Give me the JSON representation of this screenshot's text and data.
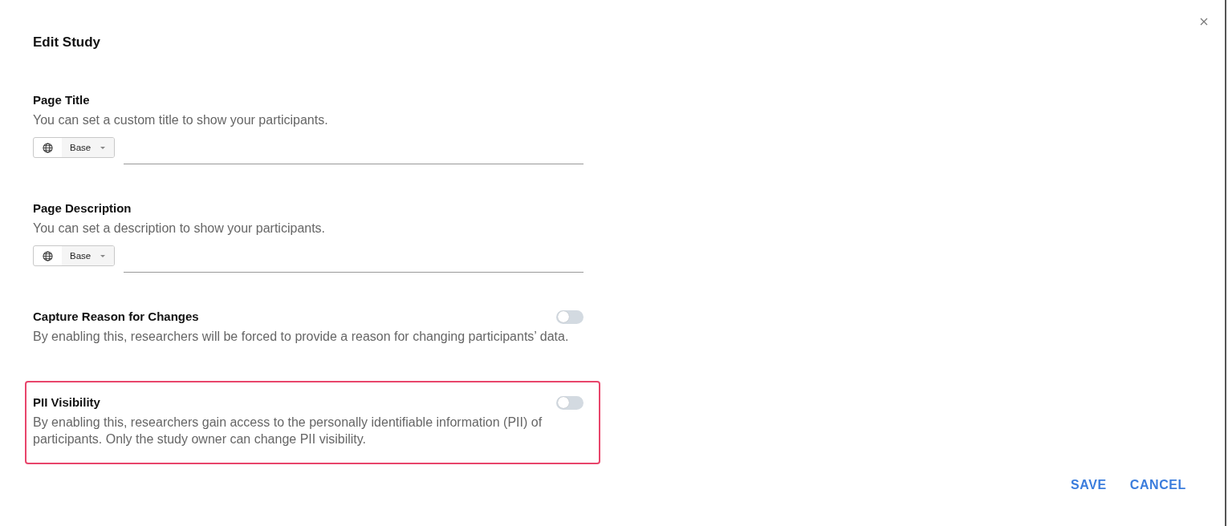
{
  "dialog": {
    "title": "Edit Study"
  },
  "sections": [
    {
      "kind": "localized_input",
      "label": "Page Title",
      "description": "You can set a custom title to show your participants.",
      "language": "Base",
      "highlighted": false
    },
    {
      "kind": "localized_input",
      "label": "Page Description",
      "description": "You can set a description to show your participants.",
      "language": "Base",
      "highlighted": false
    },
    {
      "kind": "toggle",
      "label": "Capture Reason for Changes",
      "description": "By enabling this, researchers will be forced to provide a reason for changing participants’ data.",
      "on": false,
      "highlighted": false
    },
    {
      "kind": "toggle",
      "label": "PII Visibility",
      "description": "By enabling this, researchers gain access to the personally identifiable information (PII) of participants. Only the study owner can change PII visibility.",
      "on": false,
      "highlighted": true
    }
  ],
  "buttons": [
    {
      "label": "SAVE"
    },
    {
      "label": "CANCEL"
    }
  ]
}
